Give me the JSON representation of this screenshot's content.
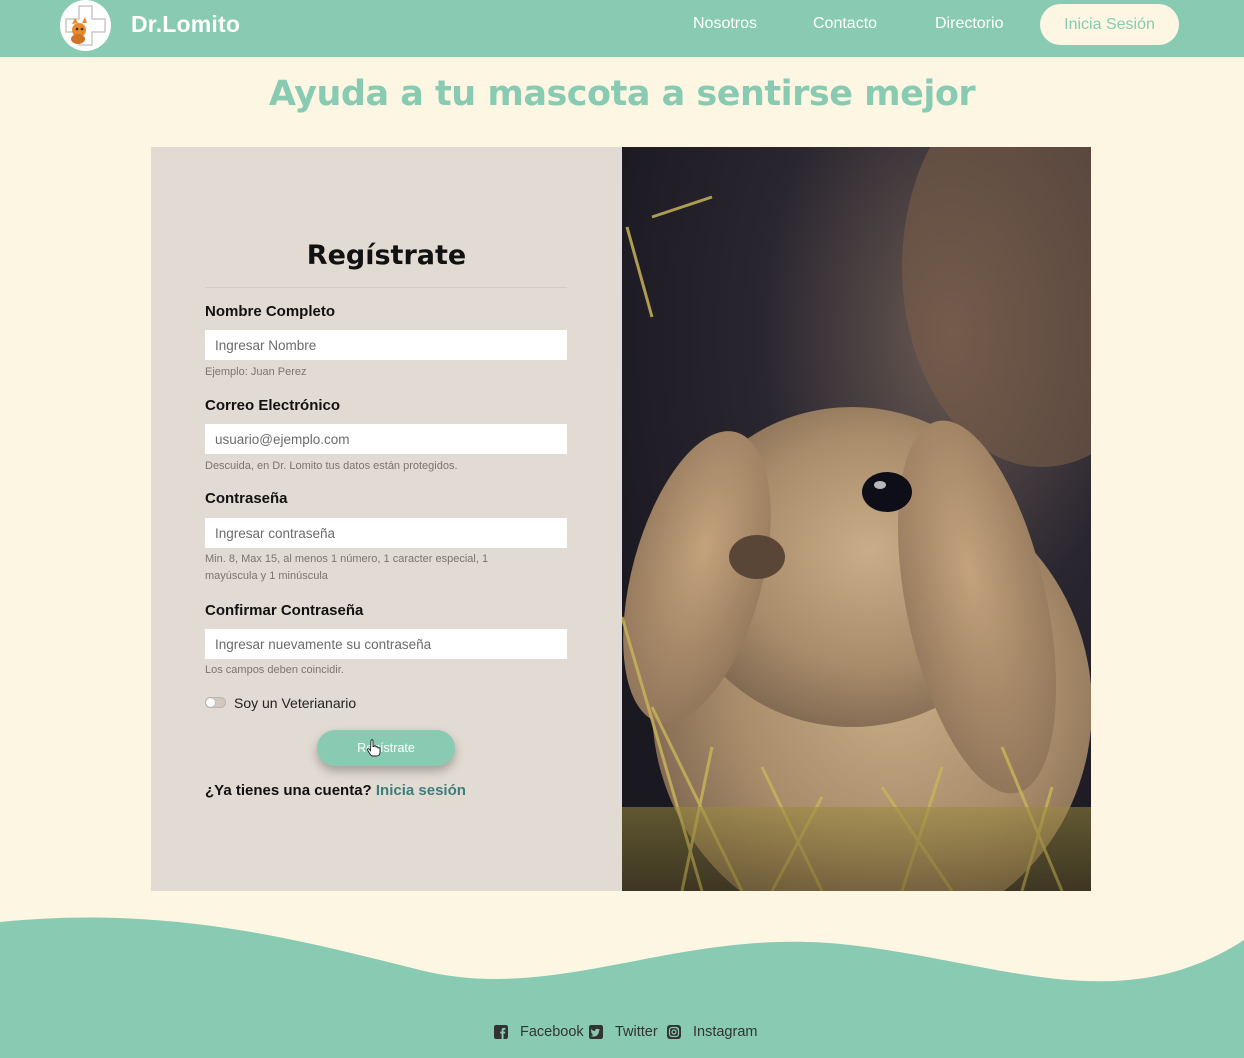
{
  "brand": {
    "name": "Dr.Lomito"
  },
  "nav": {
    "links": [
      "Nosotros",
      "Contacto",
      "Directorio"
    ],
    "login_label": "Inicia Sesión"
  },
  "headline": "Ayuda a tu mascota a sentirse mejor",
  "form": {
    "title": "Regístrate",
    "fields": [
      {
        "label": "Nombre Completo",
        "placeholder": "Ingresar Nombre",
        "help": "Ejemplo: Juan Perez"
      },
      {
        "label": "Correo Electrónico",
        "placeholder": "usuario@ejemplo.com",
        "help": "Descuida, en Dr. Lomito tus datos están protegidos."
      },
      {
        "label": "Contraseña",
        "placeholder": "Ingresar contraseña",
        "help": "Min. 8, Max 15, al menos 1 número, 1 caracter especial, 1 mayúscula y 1 minúscula"
      },
      {
        "label": "Confirmar Contraseña",
        "placeholder": "Ingresar nuevamente su contraseña",
        "help": "Los campos deben coincidir."
      }
    ],
    "toggle_label": "Soy un Veterianario",
    "toggle_on": false,
    "submit_label": "Regístrate",
    "account_prompt": "¿Ya tienes una cuenta?",
    "account_link": "Inicia sesión"
  },
  "image": {
    "subject": "rabbit-photo"
  },
  "footer": {
    "social": [
      "Facebook",
      "Twitter",
      "Instagram"
    ]
  },
  "colors": {
    "primary": "#88cbb2",
    "background": "#fdf6e3",
    "panel": "#e2dbd3",
    "link": "#3e7e7a"
  }
}
